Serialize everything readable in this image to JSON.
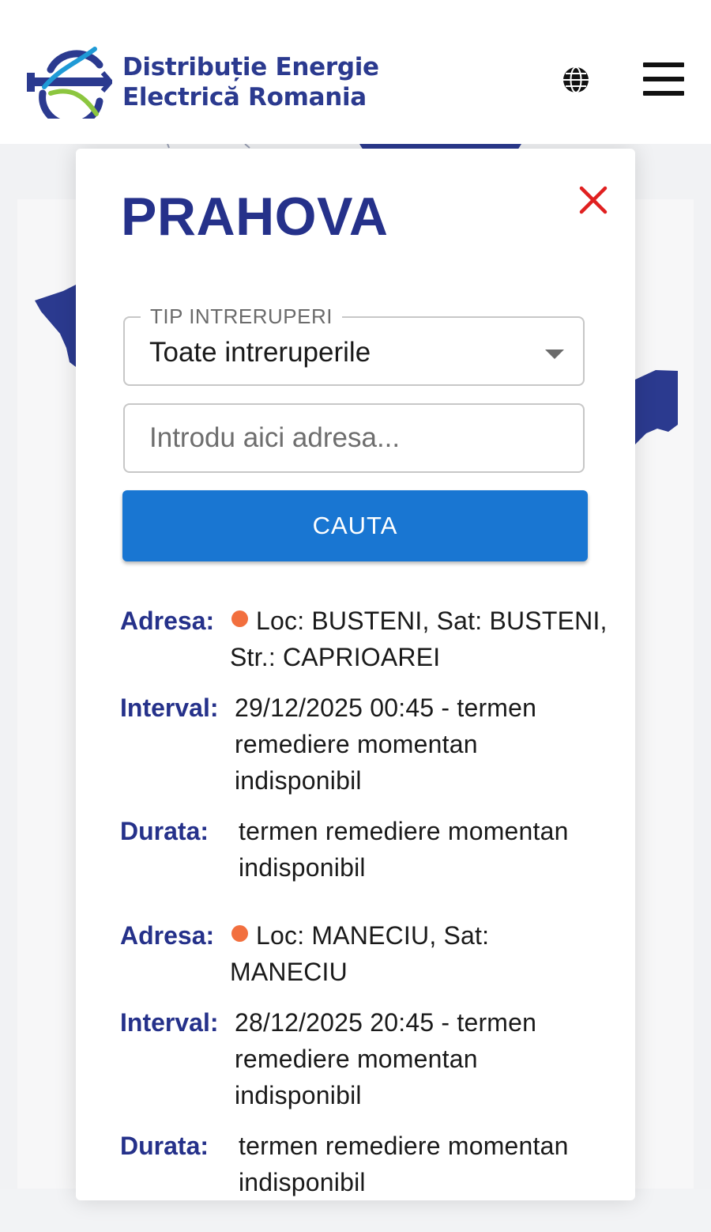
{
  "header": {
    "brand_line1": "Distribuție Energie",
    "brand_line2": "Electrică Romania",
    "logo_icon": "dee-logo-icon",
    "language_icon": "globe-icon",
    "menu_icon": "hamburger-menu-icon"
  },
  "panel": {
    "title": "PRAHOVA",
    "close_icon": "close-x-icon",
    "filter": {
      "label": "TIP INTRERUPERI",
      "selected": "Toate intreruperile"
    },
    "address": {
      "value": "",
      "placeholder": "Introdu aici adresa..."
    },
    "search_label": "CAUTA"
  },
  "labels": {
    "address": "Adresa:",
    "interval": "Interval:",
    "duration": "Durata:"
  },
  "results": [
    {
      "address": "Loc: BUSTENI, Sat: BUSTENI, Str.: CAPRIOAREI",
      "interval": "29/12/2025 00:45 - termen remediere momentan indisponibil",
      "duration": "termen remediere momentan indisponibil"
    },
    {
      "address": "Loc: MANECIU, Sat: MANECIU",
      "interval": "28/12/2025 20:45 - termen remediere momentan indisponibil",
      "duration": "termen remediere momentan indisponibil"
    }
  ],
  "colors": {
    "brand_blue": "#25318a",
    "button_blue": "#1976d2",
    "close_red": "#e02020",
    "status_dot": "#f26f3e",
    "logo_cyan": "#1f9ad6",
    "logo_green": "#8cc63f"
  }
}
